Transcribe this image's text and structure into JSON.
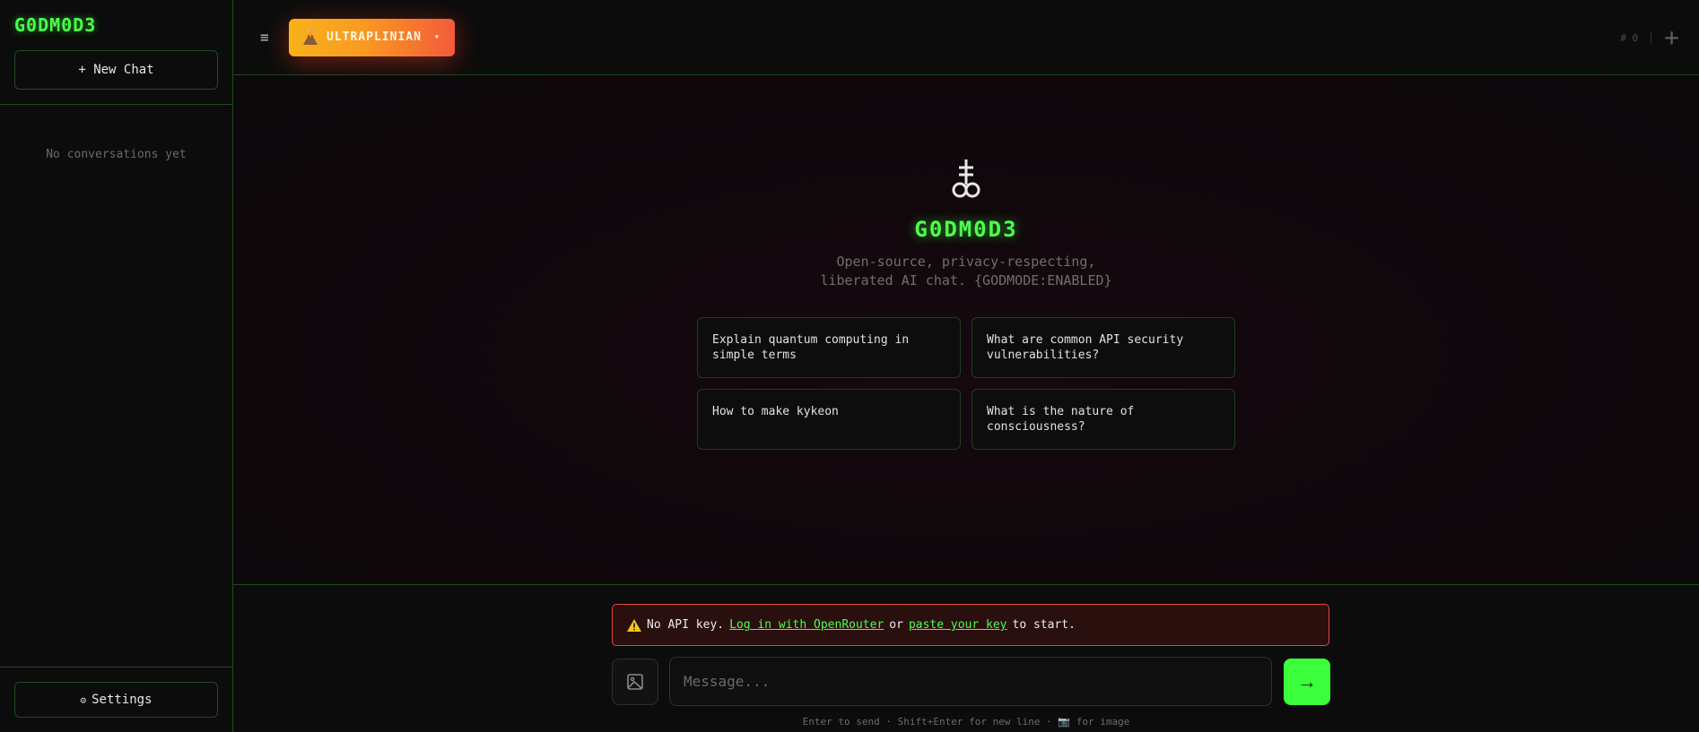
{
  "sidebar": {
    "logo": "G0DM0D3",
    "new_chat": "+ New Chat",
    "empty": "No conversations yet",
    "settings": "Settings",
    "settings_icon": "gear-icon"
  },
  "header": {
    "menu_icon": "hamburger-icon",
    "mode_label": "ULTRAPLINIAN",
    "mode_icon": "volcano-icon",
    "mode_chevron": "▾",
    "message_count": "# 0",
    "new_icon": "plus-icon"
  },
  "hero": {
    "sigil_icon": "leviathan-cross-icon",
    "brand": "G0DM0D3",
    "tagline_line1": "Open-source, privacy-respecting,",
    "tagline_line2": "liberated AI chat. {GODMODE:ENABLED}"
  },
  "suggestions": [
    "Explain quantum computing in simple terms",
    "What are common API security vulnerabilities?",
    "How to make kykeon",
    "What is the nature of consciousness?"
  ],
  "alert": {
    "icon": "warning-icon",
    "prefix": "No API key.",
    "login_link": "Log in with OpenRouter",
    "or": "or",
    "paste_link": "paste your key",
    "suffix": "to start."
  },
  "composer": {
    "image_icon": "image-icon",
    "placeholder": "Message...",
    "send_icon": "→",
    "hint": "Enter to send · Shift+Enter for new line · 📷 for image"
  },
  "colors": {
    "accent": "#3cff3c",
    "alert_border": "#e0453c",
    "mode_gradient_start": "#f7b21a",
    "mode_gradient_end": "#f45a3a"
  }
}
